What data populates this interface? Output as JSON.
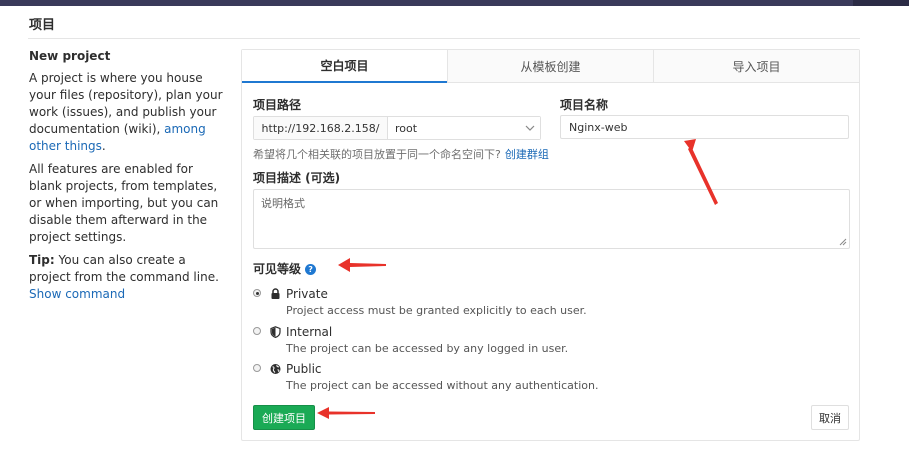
{
  "page": {
    "title": "项目"
  },
  "sidebar": {
    "heading": "New project",
    "para1_text": "A project is where you house your files (repository), plan your work (issues), and publish your documentation (wiki),",
    "para1_link": "among other things",
    "para1_end": ".",
    "para2": "All features are enabled for blank projects, from templates, or when importing, but you can disable them afterward in the project settings.",
    "tip_label": "Tip:",
    "tip_text": "You can also create a project from the command line.",
    "tip_link": "Show command"
  },
  "tabs": [
    {
      "label": "空白项目",
      "active": true
    },
    {
      "label": "从模板创建",
      "active": false
    },
    {
      "label": "导入项目",
      "active": false
    }
  ],
  "form": {
    "path_label": "项目路径",
    "path_prefix": "http://192.168.2.158/",
    "namespace_value": "root",
    "name_label": "项目名称",
    "name_value": "Nginx-web",
    "hint_text": "希望将几个相关联的项目放置于同一个命名空间下?",
    "hint_link": "创建群组",
    "desc_label": "项目描述 (可选)",
    "desc_placeholder": "说明格式",
    "visibility_label": "可见等级",
    "visibility_options": [
      {
        "icon": "lock-icon",
        "title": "Private",
        "desc": "Project access must be granted explicitly to each user.",
        "checked": true
      },
      {
        "icon": "shield-icon",
        "title": "Internal",
        "desc": "The project can be accessed by any logged in user.",
        "checked": false
      },
      {
        "icon": "globe-icon",
        "title": "Public",
        "desc": "The project can be accessed without any authentication.",
        "checked": false
      }
    ],
    "create_button": "创建项目",
    "cancel_button": "取消"
  },
  "colors": {
    "accent": "#1f78d1",
    "create_button": "#1aaa55",
    "annotation_arrow": "#e8322a",
    "link": "#1b69b6"
  }
}
